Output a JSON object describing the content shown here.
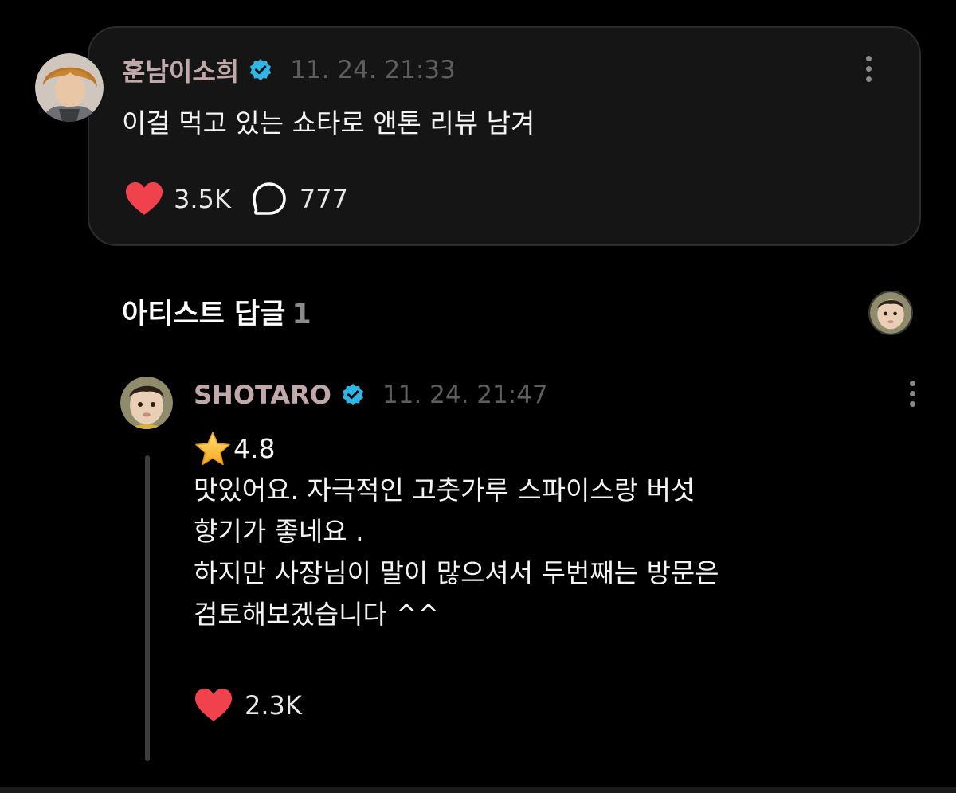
{
  "post": {
    "author": "훈남이소희",
    "timestamp": "11. 24. 21:33",
    "text": "이걸 먹고 있는 쇼타로 앤톤 리뷰 남겨",
    "likes": "3.5K",
    "comments": "777"
  },
  "replies_section": {
    "title": "아티스트 답글",
    "count": "1"
  },
  "reply": {
    "author": "SHOTARO",
    "timestamp": "11. 24. 21:47",
    "rating": "4.8",
    "lines": [
      "맛있어요. 자극적인 고춧가루 스파이스랑 버섯",
      "향기가 좋네요 .",
      "하지만 사장님이 말이 많으셔서 두번째는 방문은",
      "검토해보겠습니다 ^^"
    ],
    "likes": "2.3K"
  },
  "colors": {
    "background": "#000000",
    "card": "#151515",
    "author_name": "#c2a9a9",
    "verified_badge": "#2fb6e6",
    "heart": "#f0424c",
    "muted": "#5e5e5e"
  },
  "icons": [
    "verified-badge-icon",
    "more-options-icon",
    "heart-icon",
    "comment-bubble-icon",
    "star-icon"
  ]
}
